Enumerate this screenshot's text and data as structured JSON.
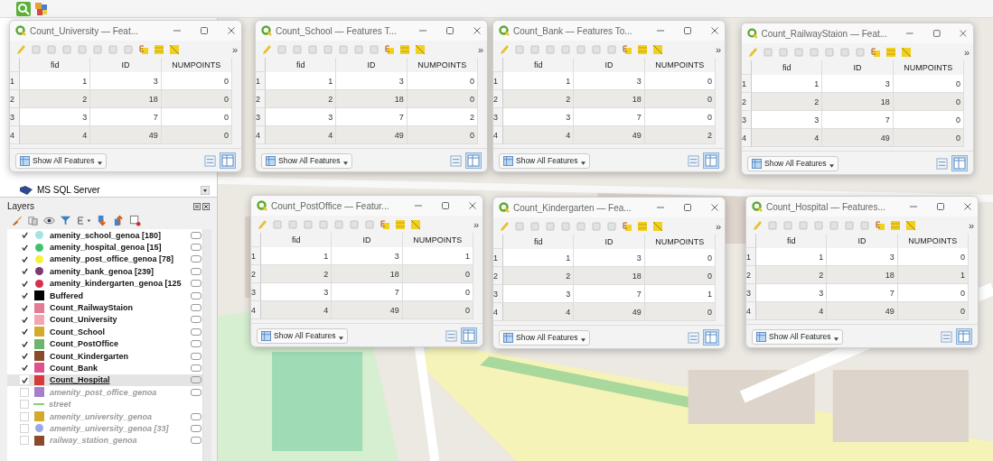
{
  "browser_panel": {
    "item": "MS SQL Server"
  },
  "layers_panel": {
    "title": "Layers",
    "layers": [
      {
        "name": "amenity_school_genoa [180]",
        "checked": true,
        "kind": "circle",
        "color": "#a6e3e3",
        "indicator": true,
        "selected": false
      },
      {
        "name": "amenity_hospital_genoa [15]",
        "checked": true,
        "kind": "circle",
        "color": "#3ec46a",
        "indicator": true,
        "selected": false
      },
      {
        "name": "amenity_post_office_genoa [78]",
        "checked": true,
        "kind": "circle",
        "color": "#f5f03c",
        "indicator": true,
        "selected": false
      },
      {
        "name": "amenity_bank_genoa [239]",
        "checked": true,
        "kind": "circle",
        "color": "#7a3b72",
        "indicator": true,
        "selected": false
      },
      {
        "name": "amenity_kindergarten_genoa [125",
        "checked": true,
        "kind": "circle",
        "color": "#d6304a",
        "indicator": true,
        "selected": false
      },
      {
        "name": "Buffered",
        "checked": true,
        "kind": "square",
        "color": "#000000",
        "indicator": true,
        "selected": false
      },
      {
        "name": "Count_RailwayStaion",
        "checked": true,
        "kind": "square",
        "color": "#e77a93",
        "indicator": true,
        "selected": false
      },
      {
        "name": "Count_University",
        "checked": true,
        "kind": "square",
        "color": "#f2a6b4",
        "indicator": true,
        "selected": false
      },
      {
        "name": "Count_School",
        "checked": true,
        "kind": "square",
        "color": "#d4aa2e",
        "indicator": true,
        "selected": false
      },
      {
        "name": "Count_PostOffice",
        "checked": true,
        "kind": "square",
        "color": "#6db56d",
        "indicator": true,
        "selected": false
      },
      {
        "name": "Count_Kindergarten",
        "checked": true,
        "kind": "square",
        "color": "#8b4a2a",
        "indicator": true,
        "selected": false
      },
      {
        "name": "Count_Bank",
        "checked": true,
        "kind": "square",
        "color": "#e0508a",
        "indicator": true,
        "selected": false
      },
      {
        "name": "Count_Hospital",
        "checked": true,
        "kind": "square",
        "color": "#d63a3a",
        "indicator": true,
        "selected": true
      },
      {
        "name": "amenity_post_office_genoa",
        "checked": false,
        "kind": "square",
        "color": "#a57fcc",
        "indicator": true,
        "selected": false
      },
      {
        "name": "street",
        "checked": false,
        "kind": "line",
        "color": "#8ccc7a",
        "indicator": false,
        "selected": false
      },
      {
        "name": "amenity_university_genoa",
        "checked": false,
        "kind": "square",
        "color": "#d4aa2e",
        "indicator": true,
        "selected": false
      },
      {
        "name": "amenity_university_genoa [33]",
        "checked": false,
        "kind": "circle",
        "color": "#9aa8e6",
        "indicator": true,
        "selected": false
      },
      {
        "name": "railway_station_genoa",
        "checked": false,
        "kind": "square",
        "color": "#8b4a2a",
        "indicator": true,
        "selected": false
      }
    ]
  },
  "attribute_windows": [
    {
      "title": "Count_University — Feat...",
      "overflow": "»",
      "columns": [
        "fid",
        "ID",
        "NUMPOINTS"
      ],
      "rows": [
        {
          "header": "1",
          "cells": [
            "1",
            "3",
            "0"
          ]
        },
        {
          "header": "2",
          "cells": [
            "2",
            "18",
            "0"
          ]
        },
        {
          "header": "3",
          "cells": [
            "3",
            "7",
            "0"
          ]
        },
        {
          "header": "4",
          "cells": [
            "4",
            "49",
            "0"
          ]
        }
      ],
      "filter_button": "Show All Features"
    },
    {
      "title": "Count_School — Features T...",
      "overflow": "»",
      "columns": [
        "fid",
        "ID",
        "NUMPOINTS"
      ],
      "rows": [
        {
          "header": "1",
          "cells": [
            "1",
            "3",
            "0"
          ]
        },
        {
          "header": "2",
          "cells": [
            "2",
            "18",
            "0"
          ]
        },
        {
          "header": "3",
          "cells": [
            "3",
            "7",
            "2"
          ]
        },
        {
          "header": "4",
          "cells": [
            "4",
            "49",
            "0"
          ]
        }
      ],
      "filter_button": "Show All Features"
    },
    {
      "title": "Count_Bank — Features To...",
      "overflow": "»",
      "columns": [
        "fid",
        "ID",
        "NUMPOINTS"
      ],
      "rows": [
        {
          "header": "1",
          "cells": [
            "1",
            "3",
            "0"
          ]
        },
        {
          "header": "2",
          "cells": [
            "2",
            "18",
            "0"
          ]
        },
        {
          "header": "3",
          "cells": [
            "3",
            "7",
            "0"
          ]
        },
        {
          "header": "4",
          "cells": [
            "4",
            "49",
            "2"
          ]
        }
      ],
      "filter_button": "Show All Features"
    },
    {
      "title": "Count_RailwayStaion — Feat...",
      "overflow": "»",
      "columns": [
        "fid",
        "ID",
        "NUMPOINTS"
      ],
      "rows": [
        {
          "header": "1",
          "cells": [
            "1",
            "3",
            "0"
          ]
        },
        {
          "header": "2",
          "cells": [
            "2",
            "18",
            "0"
          ]
        },
        {
          "header": "3",
          "cells": [
            "3",
            "7",
            "0"
          ]
        },
        {
          "header": "4",
          "cells": [
            "4",
            "49",
            "0"
          ]
        }
      ],
      "filter_button": "Show All Features"
    },
    {
      "title": "Count_PostOffice — Featur...",
      "overflow": "»",
      "columns": [
        "fid",
        "ID",
        "NUMPOINTS"
      ],
      "rows": [
        {
          "header": "1",
          "cells": [
            "1",
            "3",
            "1"
          ]
        },
        {
          "header": "2",
          "cells": [
            "2",
            "18",
            "0"
          ]
        },
        {
          "header": "3",
          "cells": [
            "3",
            "7",
            "0"
          ]
        },
        {
          "header": "4",
          "cells": [
            "4",
            "49",
            "0"
          ]
        }
      ],
      "filter_button": "Show All Features"
    },
    {
      "title": "Count_Kindergarten — Fea...",
      "overflow": "»",
      "columns": [
        "fid",
        "ID",
        "NUMPOINTS"
      ],
      "rows": [
        {
          "header": "1",
          "cells": [
            "1",
            "3",
            "0"
          ]
        },
        {
          "header": "2",
          "cells": [
            "2",
            "18",
            "0"
          ]
        },
        {
          "header": "3",
          "cells": [
            "3",
            "7",
            "1"
          ]
        },
        {
          "header": "4",
          "cells": [
            "4",
            "49",
            "0"
          ]
        }
      ],
      "filter_button": "Show All Features"
    },
    {
      "title": "Count_Hospital — Features...",
      "overflow": "»",
      "columns": [
        "fid",
        "ID",
        "NUMPOINTS"
      ],
      "rows": [
        {
          "header": "1",
          "cells": [
            "1",
            "3",
            "0"
          ]
        },
        {
          "header": "2",
          "cells": [
            "2",
            "18",
            "1"
          ]
        },
        {
          "header": "3",
          "cells": [
            "3",
            "7",
            "0"
          ]
        },
        {
          "header": "4",
          "cells": [
            "4",
            "49",
            "0"
          ]
        }
      ],
      "filter_button": "Show All Features"
    }
  ]
}
